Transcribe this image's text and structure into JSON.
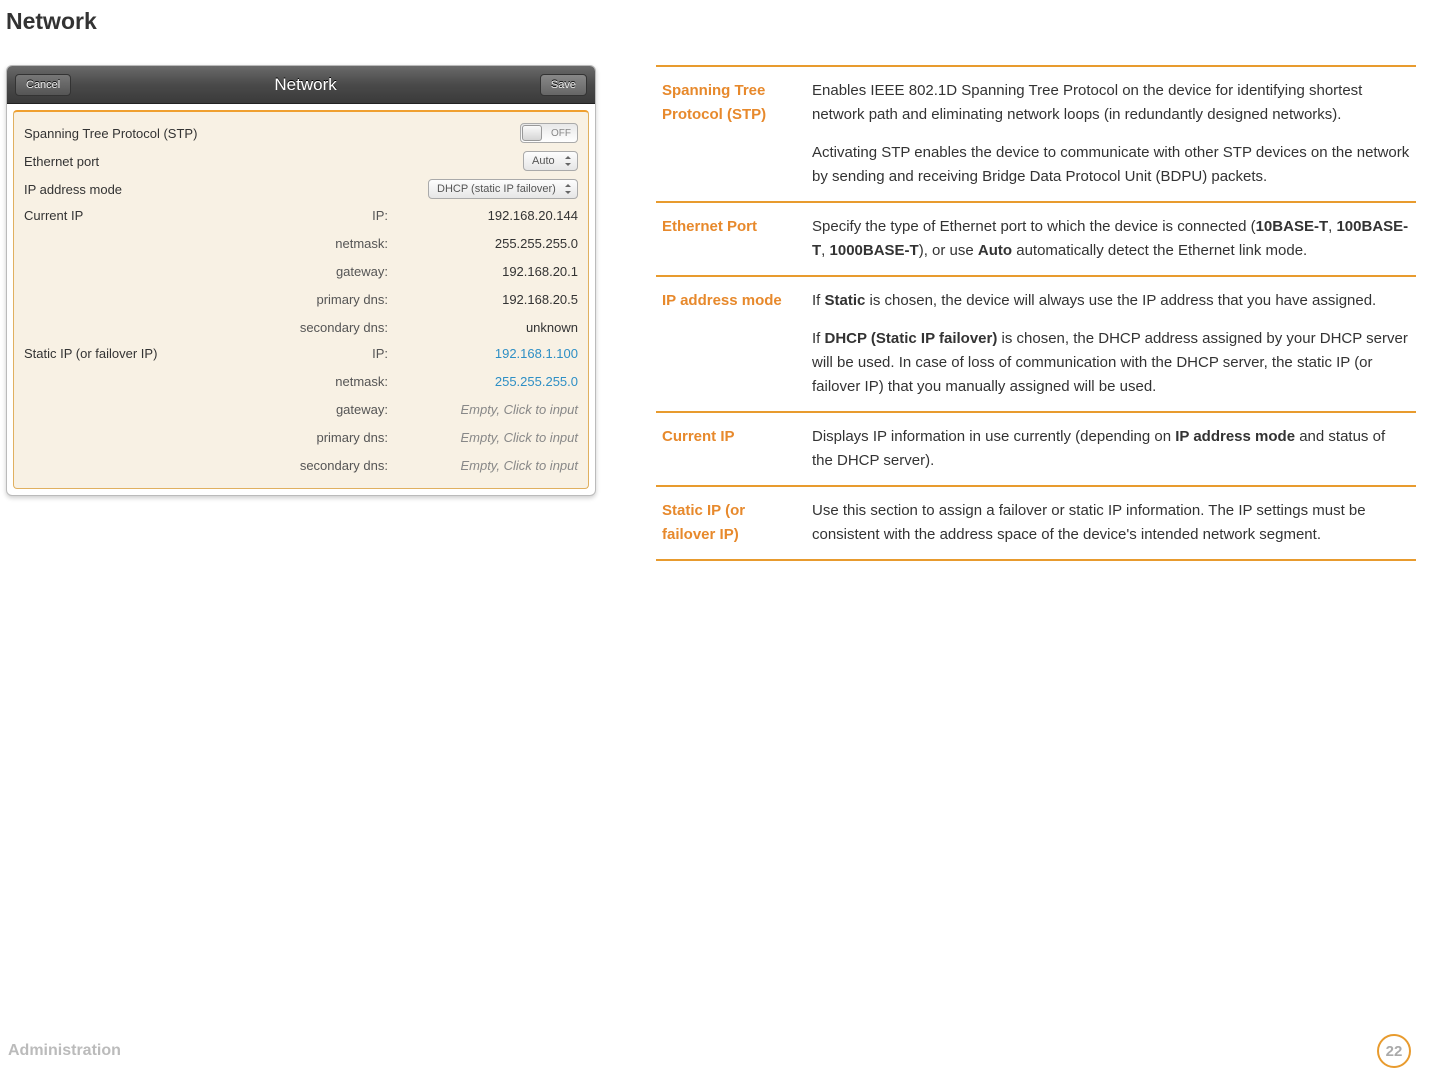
{
  "page": {
    "title": "Network",
    "footer_section": "Administration",
    "page_number": "22"
  },
  "panel": {
    "cancel": "Cancel",
    "save": "Save",
    "title": "Network",
    "stp_label": "Spanning Tree Protocol (STP)",
    "stp_value": "OFF",
    "eth_label": "Ethernet port",
    "eth_value": "Auto",
    "ipmode_label": "IP address mode",
    "ipmode_value": "DHCP (static IP failover)",
    "current_ip_label": "Current IP",
    "static_ip_label": "Static IP (or failover IP)",
    "rows_current": [
      {
        "k": "IP:",
        "v": "192.168.20.144"
      },
      {
        "k": "netmask:",
        "v": "255.255.255.0"
      },
      {
        "k": "gateway:",
        "v": "192.168.20.1"
      },
      {
        "k": "primary dns:",
        "v": "192.168.20.5"
      },
      {
        "k": "secondary dns:",
        "v": "unknown"
      }
    ],
    "rows_static": [
      {
        "k": "IP:",
        "v": "192.168.1.100",
        "link": true
      },
      {
        "k": "netmask:",
        "v": "255.255.255.0",
        "link": true
      },
      {
        "k": "gateway:",
        "v": "Empty, Click to input",
        "empty": true
      },
      {
        "k": "primary dns:",
        "v": "Empty, Click to input",
        "empty": true
      },
      {
        "k": "secondary dns:",
        "v": "Empty, Click to input",
        "empty": true
      }
    ]
  },
  "defs": [
    {
      "term": "Spanning Tree Protocol (STP)",
      "paras": [
        "Enables IEEE 802.1D Spanning Tree Protocol on the device for identifying shortest network path and eliminating network loops (in redundantly designed networks).",
        "Activating STP enables the device to communicate with other STP devices on the network by sending and receiving Bridge Data Protocol Unit (BDPU) packets."
      ]
    },
    {
      "term": "Ethernet Port",
      "paras": [
        "Specify the type of Ethernet port to which the device is connected (<b>10BASE-T</b>, <b>100BASE-T</b>, <b>1000BASE-T</b>), or use <b>Auto</b> automatically detect the Ethernet link mode."
      ]
    },
    {
      "term": "IP address mode",
      "paras": [
        "If <b>Static</b> is chosen, the device will always use the IP address that you have assigned.",
        "If <b>DHCP (Static IP failover)</b> is chosen, the DHCP address assigned by your DHCP server will be used. In case of loss of communication with the DHCP server, the static IP (or failover IP) that you manually assigned will be used."
      ]
    },
    {
      "term": "Current IP",
      "paras": [
        "Displays IP information in use currently (depending on <b>IP address mode</b> and status of the DHCP server)."
      ]
    },
    {
      "term": "Static IP (or failover IP)",
      "paras": [
        "Use this section to assign a failover or static IP information. The IP settings must be consistent with the address space of the device's intended network segment."
      ]
    }
  ]
}
